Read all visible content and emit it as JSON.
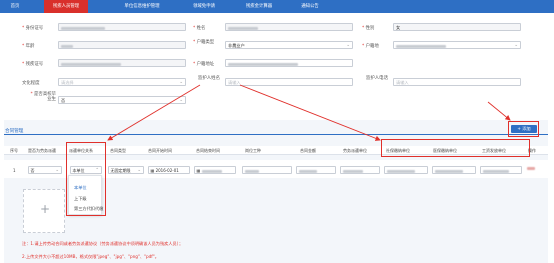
{
  "nav": {
    "tabs": [
      {
        "label": "首页",
        "active": false
      },
      {
        "label": "残疾人员管理",
        "active": true
      },
      {
        "label": "单位信息维护管理",
        "active": false
      },
      {
        "label": "领域免申请",
        "active": false
      },
      {
        "label": "残疾金计算器",
        "active": false
      },
      {
        "label": "通知公告",
        "active": false
      }
    ]
  },
  "form": {
    "id_number_label": "身份证号",
    "name_label": "姓名",
    "gender_label": "性别",
    "gender_value": "女",
    "age_label": "年龄",
    "household_type_label": "户籍类型",
    "household_type_value": "非農业户",
    "household_location_label": "户籍地",
    "disability_id_label": "残疾证号",
    "household_address_label": "户籍地址",
    "education_label": "文化程度",
    "education_placeholder": "请选择",
    "guardian_name_label": "监护人姓名",
    "guardian_name_placeholder": "请输入",
    "guardian_phone_label": "监护人电话",
    "guardian_phone_placeholder": "请输入",
    "is_graduate_label": "是否高校毕业生",
    "is_graduate_value": "否"
  },
  "contract": {
    "section_title": "合同管理",
    "add_button": "+ 添加",
    "columns": [
      "序号",
      "是否为劳务派遣",
      "派遣单位关系",
      "合同类型",
      "合同开始时间",
      "合同结束时间",
      "岗位工种",
      "合同金额",
      "劳务派遣单位",
      "社保缴纳单位",
      "医保缴纳单位",
      "工资发放单位",
      "操作"
    ],
    "row": {
      "index": "1",
      "dispatch_value": "否",
      "relation_value": "本单位",
      "contract_type": "无固定期限",
      "start_date": "2016-02-01"
    },
    "relation_options": [
      "本单位",
      "上下级",
      "第三方代扣代缴"
    ],
    "upload_plus": "+",
    "notes": [
      "注：1.请上传劳动合同或者劳务派遣协议（劳务派遣协议中须明确该人员为残疾人员）；",
      "2.上传文件大小不超过10MB，格式仅限\"jpeg\"、\"jpg\"、\"png\"、\"pdf\"。"
    ]
  },
  "colors": {
    "nav_blue": "#2e6fc4",
    "active_red": "#d9302b",
    "annotation_red": "#e0302b"
  }
}
